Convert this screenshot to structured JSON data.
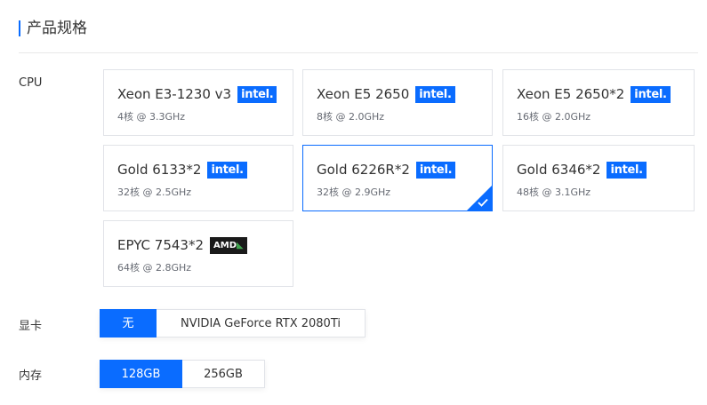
{
  "section": {
    "title": "产品规格"
  },
  "cpu": {
    "label": "CPU",
    "options": [
      {
        "name": "Xeon E3-1230 v3",
        "brand": "intel",
        "spec": "4核 @ 3.3GHz",
        "selected": false
      },
      {
        "name": "Xeon E5 2650",
        "brand": "intel",
        "spec": "8核 @ 2.0GHz",
        "selected": false
      },
      {
        "name": "Xeon E5 2650*2",
        "brand": "intel",
        "spec": "16核 @ 2.0GHz",
        "selected": false
      },
      {
        "name": "Gold 6133*2",
        "brand": "intel",
        "spec": "32核 @ 2.5GHz",
        "selected": false
      },
      {
        "name": "Gold 6226R*2",
        "brand": "intel",
        "spec": "32核 @ 2.9GHz",
        "selected": true
      },
      {
        "name": "Gold 6346*2",
        "brand": "intel",
        "spec": "48核 @ 3.1GHz",
        "selected": false
      },
      {
        "name": "EPYC 7543*2",
        "brand": "amd",
        "spec": "64核 @ 2.8GHz",
        "selected": false
      }
    ],
    "brand_labels": {
      "intel": "intel.",
      "amd": "AMD"
    }
  },
  "gpu": {
    "label": "显卡",
    "options": [
      {
        "label": "无",
        "active": true
      },
      {
        "label": "NVIDIA GeForce RTX 2080Ti",
        "active": false
      }
    ]
  },
  "memory": {
    "label": "内存",
    "options": [
      {
        "label": "128GB",
        "active": true
      },
      {
        "label": "256GB",
        "active": false
      }
    ]
  },
  "colors": {
    "accent": "#0a6cff",
    "border": "#e1e3e8",
    "amd_badge": "#1a1a1a",
    "amd_arrow": "#3fa34d"
  }
}
